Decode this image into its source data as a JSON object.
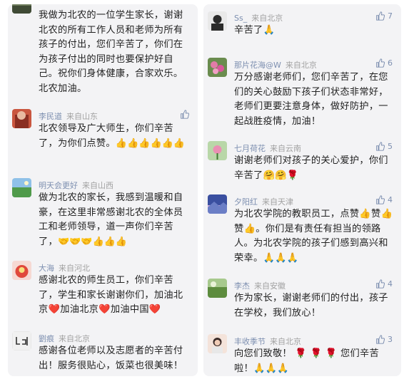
{
  "left_column": [
    {
      "text": "我做为北农的一位学生家长，谢谢北农的所有工作人员和老师为所有孩子的付出，您们辛苦了，你们在为孩子付出的同时也要保护好自己。祝你们身体健康，合家欢乐。北农加油。"
    },
    {
      "name": "李民道",
      "location": "来自山东",
      "text": "北农领导及广大师生，你们辛苦了，为你们点赞。",
      "emojis": "👍👍👍👍👍👍"
    },
    {
      "name": "明天会更好",
      "location": "来自山西",
      "text": "做为北农的家长，我感到温暖和自豪，在这里非常感谢北农的全体员工和老师领导，道一声你们辛苦了，",
      "emojis": "🤝🤝🤝👍👍👍"
    },
    {
      "name": "大海",
      "location": "来自河北",
      "text": "感谢北农的师生员工，你们辛苦了，学生和家长谢谢你们，加油北京❤️加油北京❤️加油中国❤️"
    },
    {
      "name": "劉痕",
      "location": "来自北京",
      "text": "感谢各位老师以及志愿者的辛苦付出！服务很贴心，饭菜也很美味！"
    }
  ],
  "right_column": [
    {
      "name": "Ss_",
      "location": "来自北京",
      "likes": "7",
      "text": "辛苦了🙏"
    },
    {
      "name": "那片花海@W",
      "location": "来自北京",
      "likes": "6",
      "text": "万分感谢老师们，您们辛苦了，在您们的关心鼓励下孩子们状态非常好，老师们更要注意身体，做好防护，一起战胜疫情，加油！"
    },
    {
      "name": "七月荷花",
      "location": "来自云南",
      "likes": "5",
      "text": "谢谢老师们对孩子的关心爱护，你们辛苦了🤗🤗🌹"
    },
    {
      "name": "夕阳红",
      "location": "来自天津",
      "likes": "4",
      "text": "为北农学院的教职员工，点赞👍赞👍赞👍。你们是有责任有担当的领路人。为北农学院的孩子们感到高兴和荣幸。🙏🙏🙏"
    },
    {
      "name": "李杰",
      "location": "来自安徽",
      "likes": "4",
      "text": "作为家长，谢谢老师们的付出，孩子在学校，我们放心！"
    },
    {
      "name": "丰收季节",
      "location": "来自北京",
      "likes": "3",
      "text": "向您们致敬！ 🌹 🌹 🌹 您们辛苦啦！🙏🙏🙏"
    }
  ],
  "colors": {
    "background": "#f3f3f5",
    "name": "#7d8fb0",
    "location": "#a2a2a2",
    "text": "#222222"
  },
  "icons": [
    "thumb-up-icon"
  ]
}
